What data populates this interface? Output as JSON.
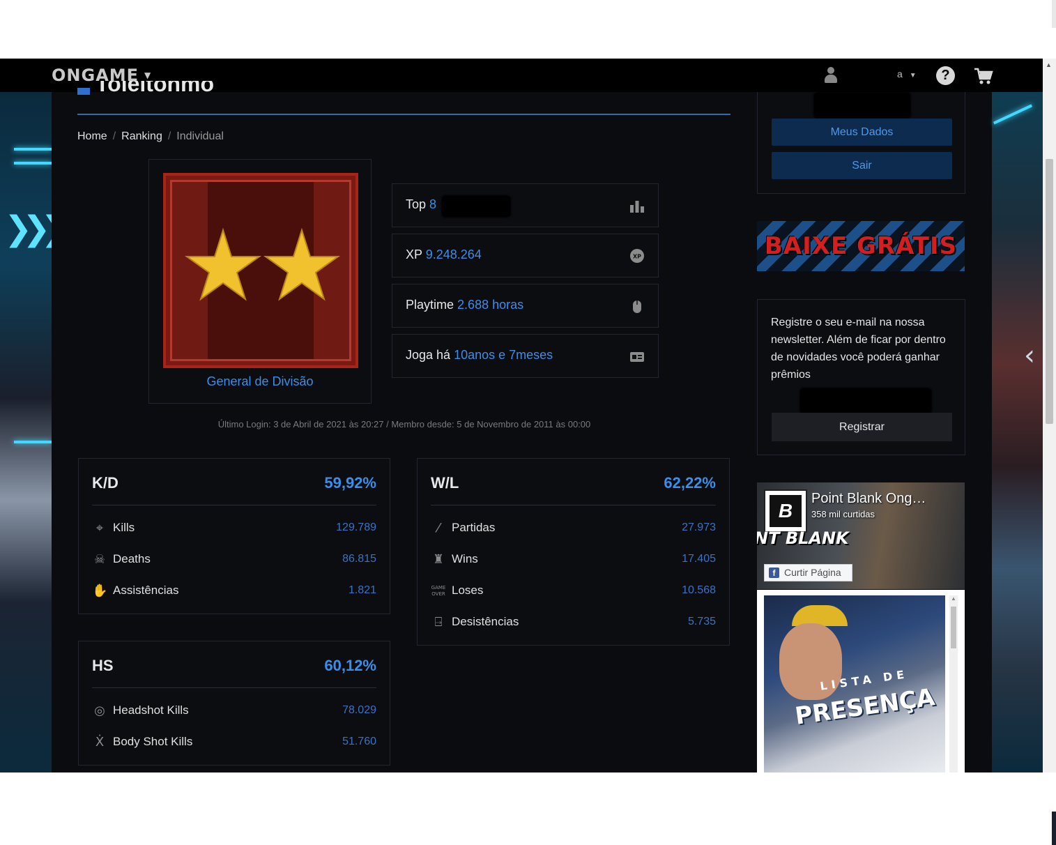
{
  "nav": {
    "logo": "ONGAME",
    "user_dropdown": "a",
    "help": "?"
  },
  "page": {
    "title_fragment": "Toleltohmo",
    "breadcrumb": {
      "home": "Home",
      "ranking": "Ranking",
      "current": "Individual"
    },
    "rank": {
      "name": "General de Divisão",
      "star_color": "#f2c12e"
    },
    "stats": {
      "top": {
        "label": "Top",
        "value": "8"
      },
      "xp": {
        "label": "XP",
        "value": "9.248.264"
      },
      "playtime": {
        "label": "Playtime",
        "value": "2.688 horas"
      },
      "joga": {
        "label": "Joga há",
        "value": "10anos e 7meses"
      }
    },
    "login_info": "Último Login: 3 de Abril de 2021 às 20:27 / Membro desde: 5 de Novembro de 2011 às 00:00",
    "kd": {
      "title": "K/D",
      "percent": "59,92%",
      "rows": [
        {
          "label": "Kills",
          "value": "129.789",
          "icon": "crosshair-icon"
        },
        {
          "label": "Deaths",
          "value": "86.815",
          "icon": "skull-icon"
        },
        {
          "label": "Assistências",
          "value": "1.821",
          "icon": "hand-icon"
        }
      ]
    },
    "wl": {
      "title": "W/L",
      "percent": "62,22%",
      "rows": [
        {
          "label": "Partidas",
          "value": "27.973",
          "icon": "rifle-icon"
        },
        {
          "label": "Wins",
          "value": "17.405",
          "icon": "trophy-icon"
        },
        {
          "label": "Loses",
          "value": "10.568",
          "icon": "game-over-icon"
        },
        {
          "label": "Desistências",
          "value": "5.735",
          "icon": "exit-door-icon"
        }
      ]
    },
    "hs": {
      "title": "HS",
      "percent": "60,12%",
      "rows": [
        {
          "label": "Headshot Kills",
          "value": "78.029",
          "icon": "head-target-icon"
        },
        {
          "label": "Body Shot Kills",
          "value": "51.760",
          "icon": "body-icon"
        }
      ]
    }
  },
  "sidebar": {
    "meus_dados": "Meus Dados",
    "sair": "Sair",
    "banner": "BAIXE GRÁTIS",
    "newsletter_text": "Registre o seu e-mail na nossa newsletter. Além de ficar por dentro de novidades você poderá ganhar prêmios",
    "registrar": "Registrar",
    "fb": {
      "page_name": "Point Blank Ong…",
      "likes": "358 mil curtidas",
      "brand": "NT BLANK",
      "like_button": "Curtir Página"
    },
    "promo": {
      "line1": "LISTA DE",
      "line2": "PRESENÇA"
    }
  },
  "colors": {
    "accent": "#3b8eea",
    "background": "#0b0c10",
    "panel_border": "#23262e"
  }
}
